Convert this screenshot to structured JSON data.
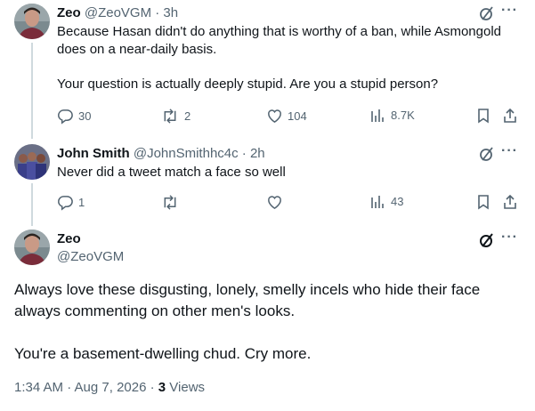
{
  "tweets": [
    {
      "name": "Zeo",
      "handle": "@ZeoVGM",
      "time": "· 3h",
      "text_line1": "Because Hasan didn't do anything that is worthy of a ban, while Asmongold",
      "text_line2": "does on a near-daily basis.",
      "text_line3": "Your question is actually deeply stupid. Are you a stupid person?",
      "replies": "30",
      "reposts": "2",
      "likes": "104",
      "views": "8.7K"
    },
    {
      "name": "John Smith",
      "handle": "@JohnSmithhc4c",
      "time": "· 2h",
      "text_line1": "Never did a tweet match a face so well",
      "replies": "1",
      "reposts": "",
      "likes": "",
      "views": "43"
    }
  ],
  "main": {
    "name": "Zeo",
    "handle": "@ZeoVGM",
    "text_line1": "Always love these disgusting, lonely, smelly incels who hide their face",
    "text_line2": "always commenting on other men's looks.",
    "text_line3": "You're a basement-dwelling chud. Cry more.",
    "timestamp": "1:34 AM · Aug 7, 2026 · ",
    "views_count": "3",
    "views_label": " Views"
  },
  "more_glyph": "···",
  "colors": {
    "muted": "#536471",
    "text": "#0f1419",
    "thread": "#cfd9de"
  }
}
